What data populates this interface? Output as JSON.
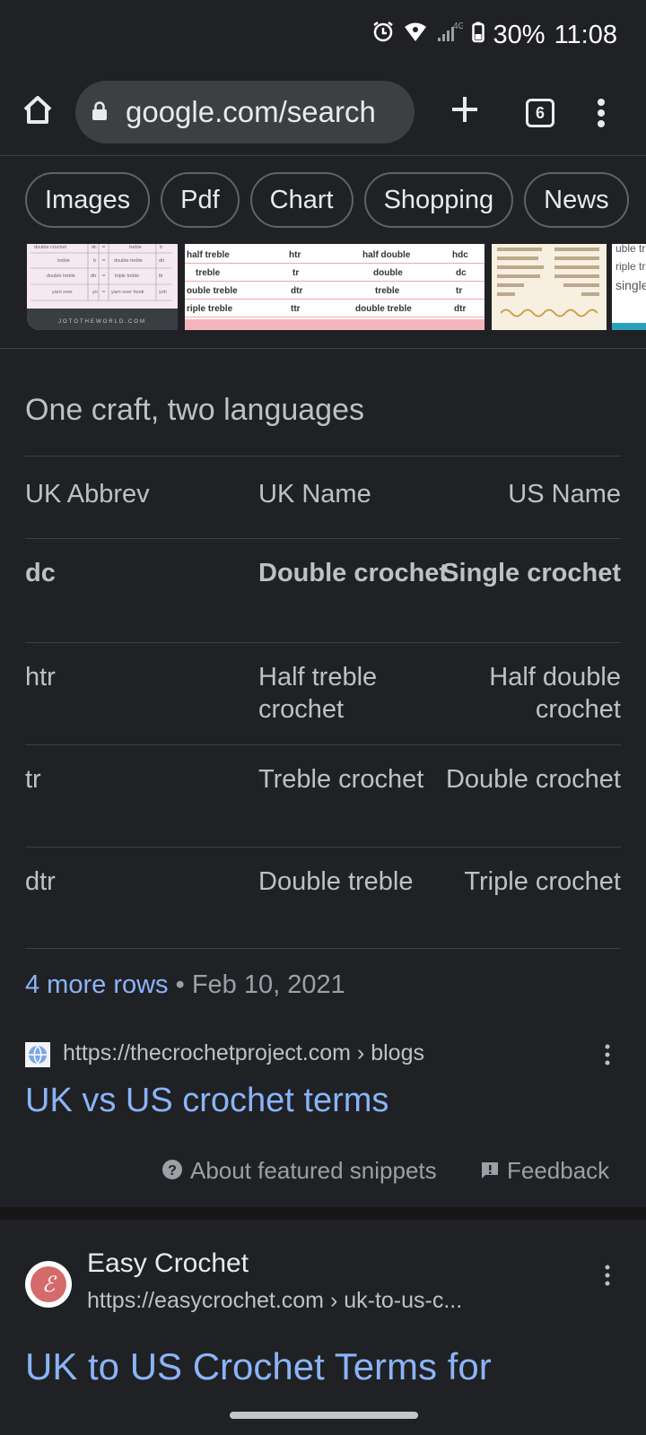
{
  "status_bar": {
    "network": "4G",
    "battery": "30%",
    "time": "11:08"
  },
  "browser": {
    "url": "google.com/search",
    "tab_count": "6"
  },
  "filter_chips": [
    "Images",
    "Pdf",
    "Chart",
    "Shopping",
    "News"
  ],
  "image_thumbs": {
    "thumb1": {
      "rows": [
        [
          "double crochet",
          "dc",
          "=",
          "treble",
          "tr"
        ],
        [
          "treble",
          "tr",
          "=",
          "double treble",
          "dtr"
        ],
        [
          "double treble",
          "dtr",
          "=",
          "triple treble",
          "ttr"
        ],
        [
          "yarn over",
          "yo",
          "=",
          "yarn over hook",
          "yoh"
        ]
      ],
      "footer": "JOTOTHEWORLD.COM"
    },
    "thumb2": {
      "rows": [
        [
          "half treble",
          "htr",
          "half double",
          "hdc"
        ],
        [
          "treble",
          "tr",
          "double",
          "dc"
        ],
        [
          "ouble treble",
          "dtr",
          "treble",
          "tr"
        ],
        [
          "riple treble",
          "ttr",
          "double treble",
          "dtr"
        ]
      ]
    },
    "thumb4": {
      "lines": [
        "uble tr",
        "riple tr",
        "single"
      ]
    }
  },
  "featured_snippet": {
    "title": "One craft, two languages",
    "headers": [
      "UK Abbrev",
      "UK Name",
      "US Name"
    ],
    "rows": [
      [
        "dc",
        "Double crochet",
        "Single crochet"
      ],
      [
        "htr",
        "Half treble crochet",
        "Half double crochet"
      ],
      [
        "tr",
        "Treble crochet",
        "Double crochet"
      ],
      [
        "dtr",
        "Double treble",
        "Triple crochet"
      ]
    ],
    "more_rows": "4 more rows",
    "separator": "•",
    "date": "Feb 10, 2021",
    "source_url": "https://thecrochetproject.com › blogs",
    "link_title": "UK vs US crochet terms",
    "about_label": "About featured snippets",
    "feedback_label": "Feedback"
  },
  "result2": {
    "logo_letter": "ℰ",
    "site_name": "Easy Crochet",
    "url": "https://easycrochet.com › uk-to-us-c...",
    "title": "UK to US Crochet Terms for"
  }
}
